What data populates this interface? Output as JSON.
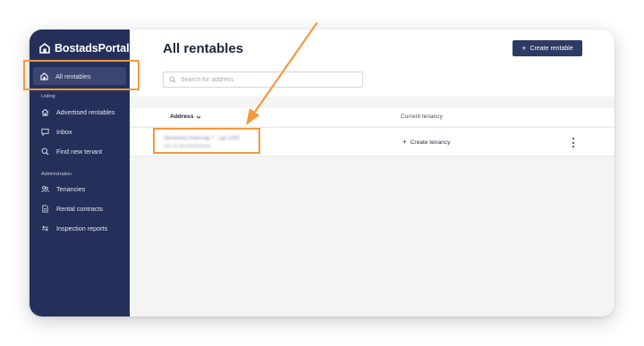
{
  "app": {
    "brand_name": "BostadsPortal"
  },
  "sidebar": {
    "top_items": [
      {
        "label": "All rentables",
        "icon": "home-icon"
      }
    ],
    "sections": [
      {
        "label": "Listing",
        "items": [
          {
            "label": "Advertised rentables",
            "icon": "house-icon"
          },
          {
            "label": "Inbox",
            "icon": "chat-icon"
          },
          {
            "label": "Find new tenant",
            "icon": "search-icon"
          }
        ]
      },
      {
        "label": "Administration",
        "items": [
          {
            "label": "Tenancies",
            "icon": "people-icon"
          },
          {
            "label": "Rental contracts",
            "icon": "document-icon"
          },
          {
            "label": "Inspection reports",
            "icon": "swap-icon"
          }
        ]
      }
    ]
  },
  "main": {
    "title": "All rentables",
    "create_button": "Create rentable",
    "search_placeholder": "Search for address",
    "table": {
      "columns": [
        "Address",
        "Current tenancy"
      ],
      "rows": [
        {
          "address_line1": "Stenbacka Kvarnväg 7 · Lgh 1203",
          "address_line2": "141 52 Stockholmsnäs",
          "action": "Create tenancy"
        }
      ]
    }
  },
  "colors": {
    "sidebar_bg": "#24305a",
    "accent": "#2d3a63",
    "annotation": "#f29a3d"
  }
}
